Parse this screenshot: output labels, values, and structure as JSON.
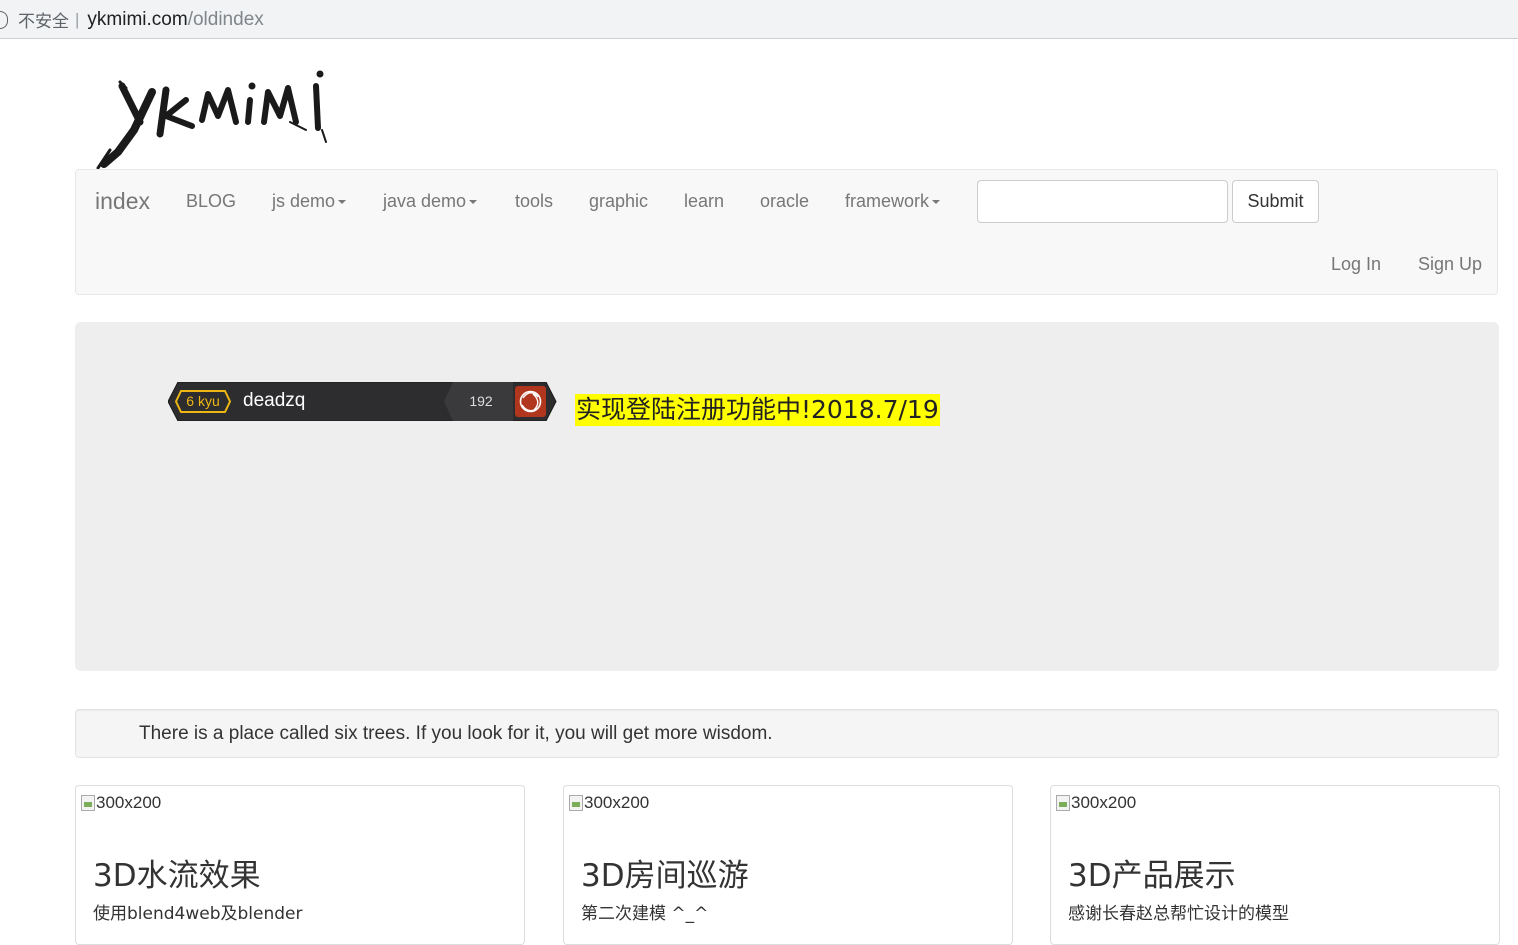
{
  "browser": {
    "security_label": "不安全",
    "separator": "|",
    "url_host": "ykmimi.com",
    "url_path": "/oldindex"
  },
  "logo": {
    "text": "ykmimi"
  },
  "navbar": {
    "brand": "index",
    "items": [
      {
        "label": "BLOG",
        "dropdown": false
      },
      {
        "label": "js demo",
        "dropdown": true
      },
      {
        "label": "java demo",
        "dropdown": true
      },
      {
        "label": "tools",
        "dropdown": false
      },
      {
        "label": "graphic",
        "dropdown": false
      },
      {
        "label": "learn",
        "dropdown": false
      },
      {
        "label": "oracle",
        "dropdown": false
      },
      {
        "label": "framework",
        "dropdown": true
      }
    ],
    "search": {
      "value": "",
      "placeholder": ""
    },
    "submit_label": "Submit",
    "login_label": "Log In",
    "signup_label": "Sign Up"
  },
  "jumbotron": {
    "badge": {
      "rank": "6 kyu",
      "username": "deadzq",
      "honor": "192",
      "rank_color": "#ecb613"
    },
    "notice": "实现登陆注册功能中!2018.7/19",
    "notice_highlight": "#ffff00"
  },
  "well": {
    "text": "There is a place called six trees. If you look for it, you will get more wisdom."
  },
  "cards": [
    {
      "image_alt": "300x200",
      "title": "3D水流效果",
      "desc": "使用blend4web及blender"
    },
    {
      "image_alt": "300x200",
      "title": "3D房间巡游",
      "desc": "第二次建模 ^_^"
    },
    {
      "image_alt": "300x200",
      "title": "3D产品展示",
      "desc": "感谢长春赵总帮忙设计的模型"
    }
  ]
}
